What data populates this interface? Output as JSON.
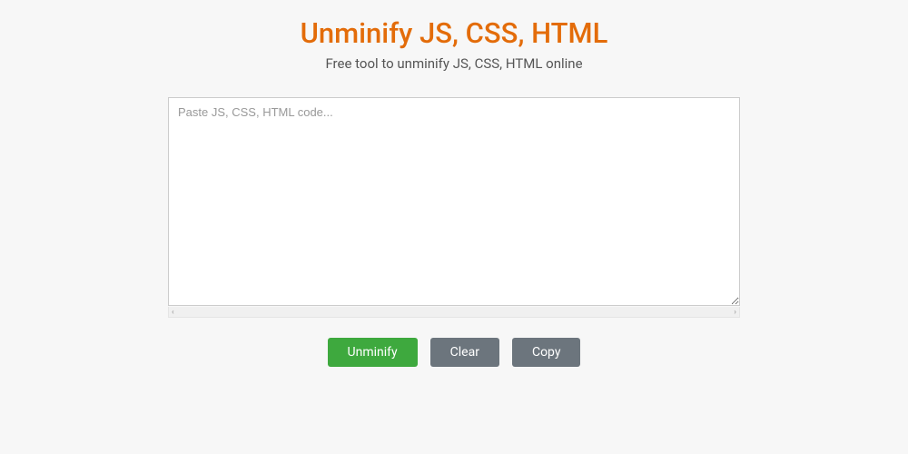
{
  "header": {
    "title": "Unminify JS, CSS, HTML",
    "subtitle": "Free tool to unminify JS, CSS, HTML online"
  },
  "editor": {
    "placeholder": "Paste JS, CSS, HTML code...",
    "value": ""
  },
  "buttons": {
    "unminify": "Unminify",
    "clear": "Clear",
    "copy": "Copy"
  }
}
